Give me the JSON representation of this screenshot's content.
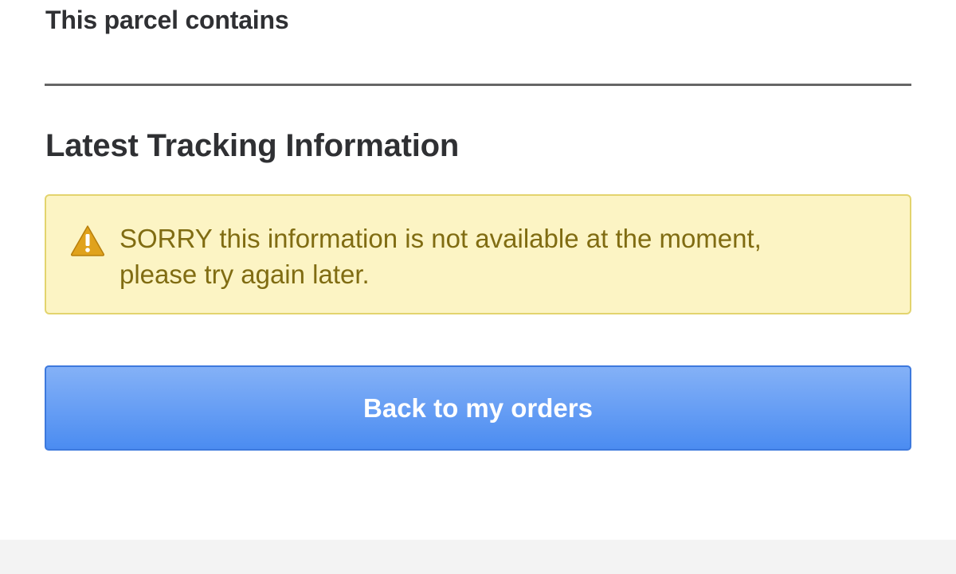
{
  "parcel": {
    "contents_heading": "This parcel contains"
  },
  "tracking": {
    "heading": "Latest Tracking Information",
    "alert": {
      "icon": "warning-triangle-icon",
      "line1": "SORRY this information is not available at the moment,",
      "line2": "please try again later."
    }
  },
  "actions": {
    "back_label": "Back to my orders"
  },
  "colors": {
    "heading_text": "#2f3033",
    "alert_background": "#fcf4c4",
    "alert_border": "#e3d46e",
    "alert_text": "#806c12",
    "warning_icon": "#e0a21c",
    "button_top": "#84b1f7",
    "button_bottom": "#4b8cf1",
    "button_border": "#3d79dd",
    "footer_background": "#f3f3f3"
  }
}
